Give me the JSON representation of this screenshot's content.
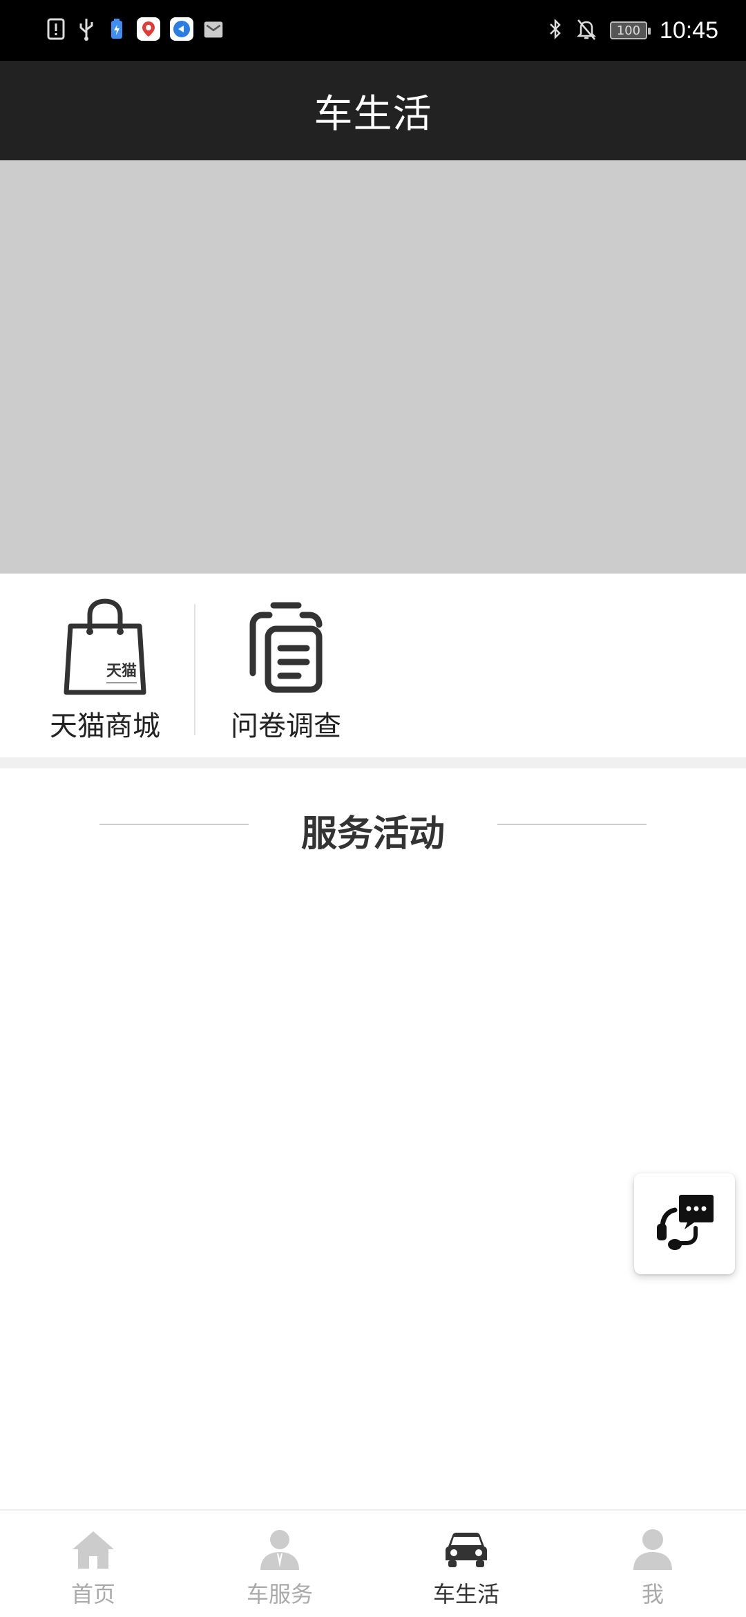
{
  "status_bar": {
    "time": "10:45",
    "battery": "100",
    "left_icons": [
      "alert-file-icon",
      "usb-icon",
      "battery-saver-icon",
      "map-app-icon",
      "browser-app-icon",
      "mail-icon"
    ],
    "right_icons": [
      "bluetooth-icon",
      "bell-off-icon",
      "battery-icon"
    ]
  },
  "header": {
    "title": "车生活"
  },
  "banner": {
    "color": "#cccccc"
  },
  "quick_entries": [
    {
      "label": "天猫商城",
      "icon": "shopping-bag-icon",
      "icon_text": "天猫"
    },
    {
      "label": "问卷调查",
      "icon": "clipboard-icon"
    }
  ],
  "section": {
    "title": "服务活动"
  },
  "float_button": {
    "icon": "customer-service-icon"
  },
  "tabbar": {
    "tabs": [
      {
        "label": "首页",
        "icon": "home-icon",
        "active": false
      },
      {
        "label": "车服务",
        "icon": "service-person-icon",
        "active": false
      },
      {
        "label": "车生活",
        "icon": "car-icon",
        "active": true
      },
      {
        "label": "我",
        "icon": "user-icon",
        "active": false
      }
    ]
  },
  "colors": {
    "header_bg": "#222222",
    "active_tab": "#333333",
    "inactive_tab": "#aaaaaa"
  }
}
